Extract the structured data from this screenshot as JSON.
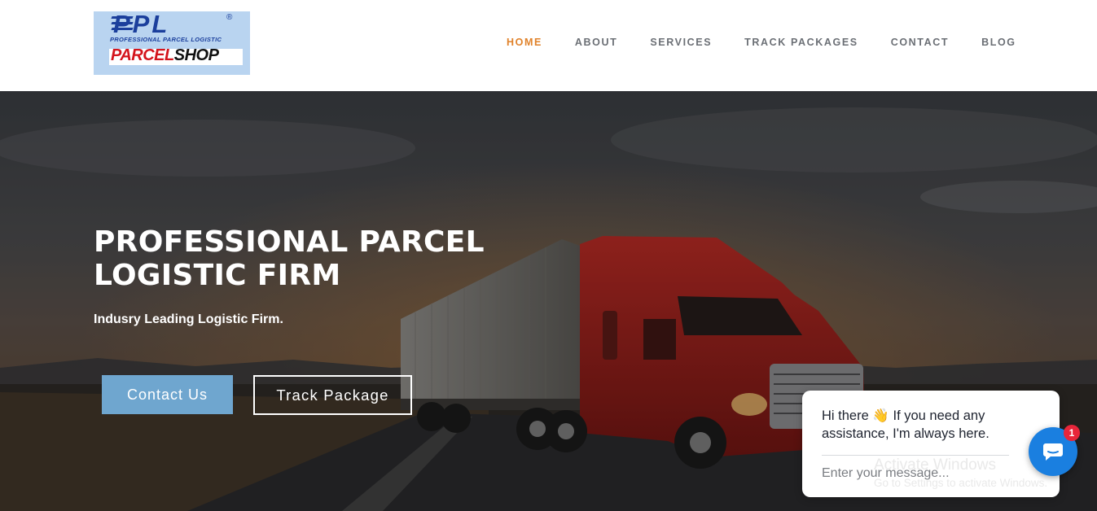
{
  "header": {
    "logo": {
      "brand": "PPL",
      "registered": "®",
      "tagline": "PROFESSIONAL PARCEL LOGISTIC",
      "shop_part1": "PARCEL",
      "shop_part2": "SHOP"
    },
    "nav": [
      {
        "label": "HOME",
        "active": true
      },
      {
        "label": "ABOUT",
        "active": false
      },
      {
        "label": "SERVICES",
        "active": false
      },
      {
        "label": "TRACK PACKAGES",
        "active": false
      },
      {
        "label": "CONTACT",
        "active": false
      },
      {
        "label": "BLOG",
        "active": false
      }
    ]
  },
  "hero": {
    "title": "PROFESSIONAL PARCEL LOGISTIC FIRM",
    "subtitle": "Indusry Leading Logistic Firm.",
    "contact_button": "Contact Us",
    "track_button": "Track Package"
  },
  "chat": {
    "message": "Hi there 👋 If you need any assistance, I'm always here.",
    "input_placeholder": "Enter your message...",
    "badge_count": "1"
  },
  "watermark": {
    "line1": "Activate Windows",
    "line2": "Go to Settings to activate Windows."
  },
  "colors": {
    "nav_active": "#e0822a",
    "nav_default": "#6b6f75",
    "contact_button_bg": "#6fa6cf",
    "chat_launcher": "#1a7fe0",
    "badge": "#e8263a",
    "logo_bg": "#b9d4f0",
    "logo_blue": "#1b3f9c",
    "logo_red": "#d4141c"
  },
  "icons": {
    "chat_launcher": "chat-bubble-icon"
  }
}
